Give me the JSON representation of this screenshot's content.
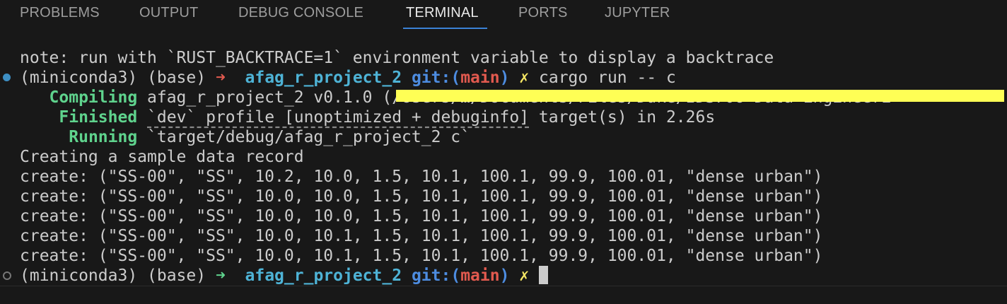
{
  "tabs": [
    {
      "label": "PROBLEMS",
      "active": false
    },
    {
      "label": "OUTPUT",
      "active": false
    },
    {
      "label": "DEBUG CONSOLE",
      "active": false
    },
    {
      "label": "TERMINAL",
      "active": true
    },
    {
      "label": "PORTS",
      "active": false
    },
    {
      "label": "JUPYTER",
      "active": false
    }
  ],
  "colors": {
    "accent": "#3b82d6",
    "highlight": "#ffff55",
    "cargo_status": "#5fd38d"
  },
  "terminal": {
    "note": "note: run with `RUST_BACKTRACE=1` environment variable to display a backtrace",
    "prompt": {
      "env": "(miniconda3) (base) ",
      "arrow": "➜",
      "dir": "afag_r_project_2",
      "git_label": "git:(",
      "branch": "main",
      "git_close": ")",
      "dirty": "✗"
    },
    "command": "cargo run -- c",
    "compiling": {
      "status": "Compiling",
      "text": " afag_r_project_2 v0.1.0 (/Users/…/Documents/Files/Duke/IDS706 Data Engineeri"
    },
    "finished": {
      "status": "Finished",
      "text_a": " ",
      "profile": "`dev` profile [unoptimized + debuginfo]",
      "text_b": " target(s) in 2.26s"
    },
    "running": {
      "status": "Running",
      "text": " `target/debug/afag_r_project_2 c`"
    },
    "output": [
      "Creating a sample data record",
      "create: (\"SS-00\", \"SS\", 10.2, 10.0, 1.5, 10.1, 100.1, 99.9, 100.01, \"dense urban\")",
      "create: (\"SS-00\", \"SS\", 10.0, 10.0, 1.5, 10.1, 100.1, 99.9, 100.01, \"dense urban\")",
      "create: (\"SS-00\", \"SS\", 10.0, 10.0, 1.5, 10.1, 100.1, 99.9, 100.01, \"dense urban\")",
      "create: (\"SS-00\", \"SS\", 10.0, 10.1, 1.5, 10.1, 100.1, 99.9, 100.01, \"dense urban\")",
      "create: (\"SS-00\", \"SS\", 10.0, 10.1, 1.5, 10.1, 100.1, 99.9, 100.01, \"dense urban\")"
    ]
  }
}
